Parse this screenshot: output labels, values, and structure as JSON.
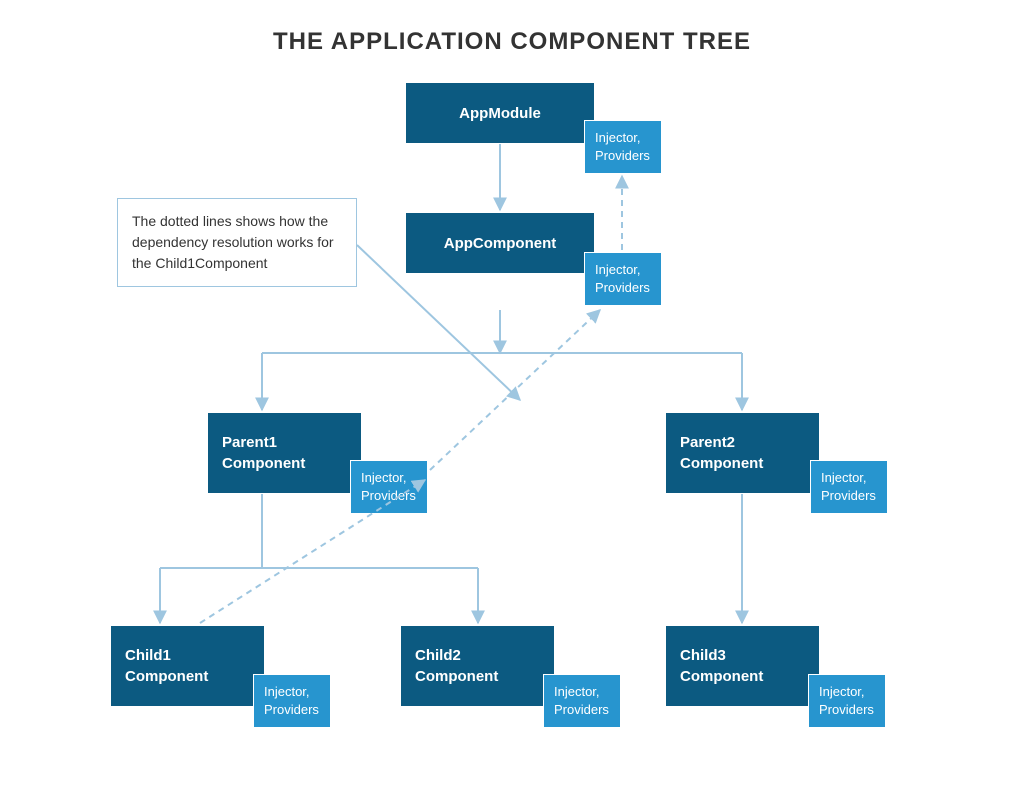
{
  "title": "THE APPLICATION COMPONENT TREE",
  "note": "The dotted lines shows how the dependency resolution works for the Child1Component",
  "badgeText": "Injector,\nProviders",
  "nodes": {
    "appModule": "AppModule",
    "appComponent": "AppComponent",
    "parent1": "Parent1\nComponent",
    "parent2": "Parent2\nComponent",
    "child1": "Child1\nComponent",
    "child2": "Child2\nComponent",
    "child3": "Child3\nComponent"
  },
  "colors": {
    "nodeFill": "#0c5a81",
    "badgeFill": "#2795cf",
    "line": "#9ec6e0"
  }
}
